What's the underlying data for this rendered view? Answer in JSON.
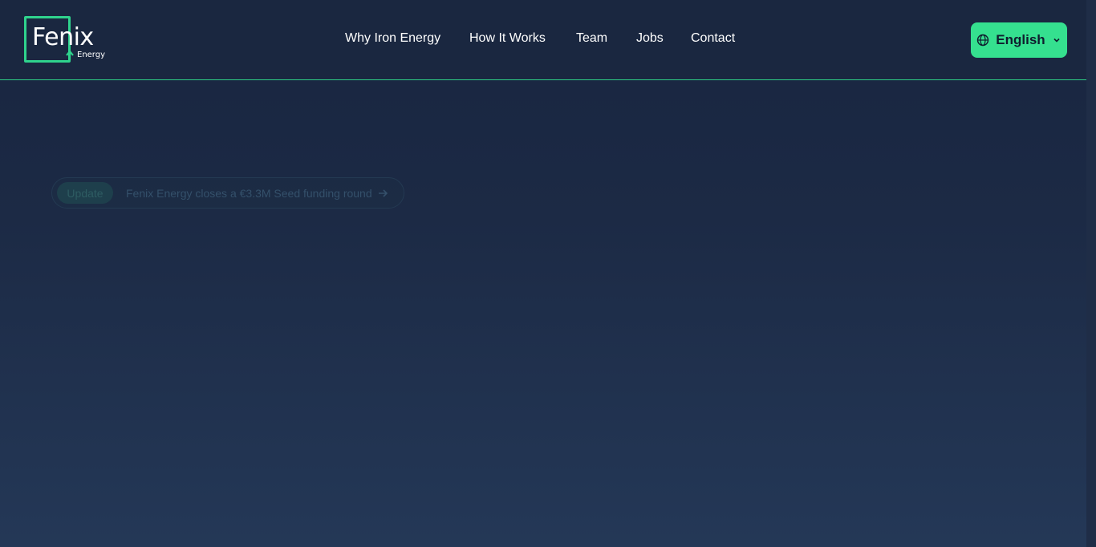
{
  "brand": {
    "name": "Fenix",
    "tagline": "Energy",
    "accent_color": "#35e08f"
  },
  "nav": {
    "items": [
      {
        "label": "Why Iron Energy"
      },
      {
        "label": "How It Works"
      },
      {
        "label": "Team"
      },
      {
        "label": "Jobs"
      },
      {
        "label": "Contact"
      }
    ]
  },
  "language": {
    "label": "English",
    "icon": "globe-icon",
    "chevron": "chevron-down-icon"
  },
  "announcement": {
    "badge": "Update",
    "text": "Fenix Energy closes a €3.3M Seed funding round",
    "icon": "arrow-right-icon"
  }
}
